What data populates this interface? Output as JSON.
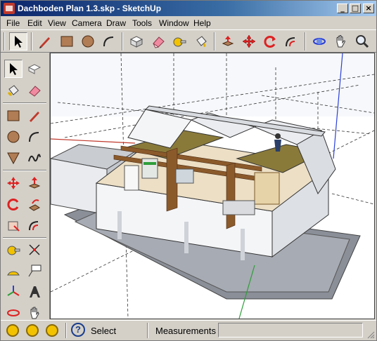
{
  "window": {
    "title": "Dachboden Plan 1.3.skp - SketchUp",
    "minimize": "_",
    "maximize": "□",
    "close": "×"
  },
  "menu": [
    "File",
    "Edit",
    "View",
    "Camera",
    "Draw",
    "Tools",
    "Window",
    "Help"
  ],
  "status": {
    "text": "Select",
    "measurements_label": "Measurements",
    "measurements_value": ""
  },
  "colors": {
    "title_active": "#0a246a",
    "chrome": "#d4d0c8",
    "axis_red": "#c0392b",
    "axis_green": "#2e9e3a",
    "axis_blue": "#2a3fd8"
  }
}
